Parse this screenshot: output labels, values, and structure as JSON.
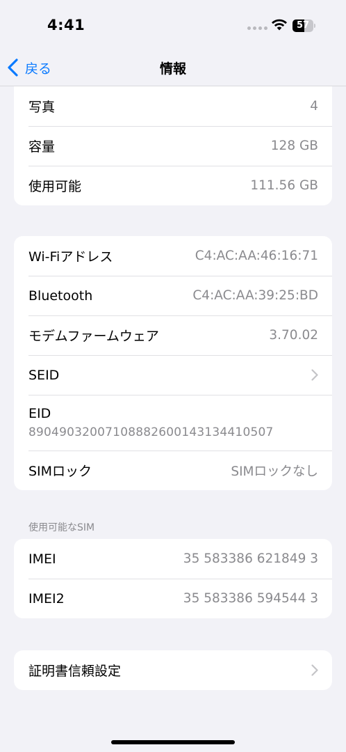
{
  "status_bar": {
    "time": "4:41",
    "battery_level": "57",
    "battery_fraction": 0.57,
    "signal_icon": "signal-dots-icon",
    "wifi_icon": "wifi-icon"
  },
  "nav": {
    "back_label": "戻る",
    "title": "情報",
    "back_icon": "chevron-left-icon"
  },
  "colors": {
    "accent": "#0a7aff",
    "background": "#f2f2f7",
    "secondary_text": "#8a8a8e"
  },
  "group_storage": {
    "rows": [
      {
        "label": "写真",
        "value": "4"
      },
      {
        "label": "容量",
        "value": "128 GB"
      },
      {
        "label": "使用可能",
        "value": "111.56 GB"
      }
    ]
  },
  "group_network": {
    "wifi": {
      "label": "Wi-Fiアドレス",
      "value": "C4:AC:AA:46:16:71"
    },
    "bluetooth": {
      "label": "Bluetooth",
      "value": "C4:AC:AA:39:25:BD"
    },
    "modem": {
      "label": "モデムファームウェア",
      "value": "3.70.02"
    },
    "seid": {
      "label": "SEID"
    },
    "eid": {
      "label": "EID",
      "value": "89049032007108882600143134410507"
    },
    "sim_lock": {
      "label": "SIMロック",
      "value": "SIMロックなし"
    }
  },
  "sim_section": {
    "header": "使用可能なSIM",
    "rows": [
      {
        "label": "IMEI",
        "value": "35 583386 621849 3"
      },
      {
        "label": "IMEI2",
        "value": "35 583386 594544 3"
      }
    ]
  },
  "cert_group": {
    "label": "証明書信頼設定"
  }
}
